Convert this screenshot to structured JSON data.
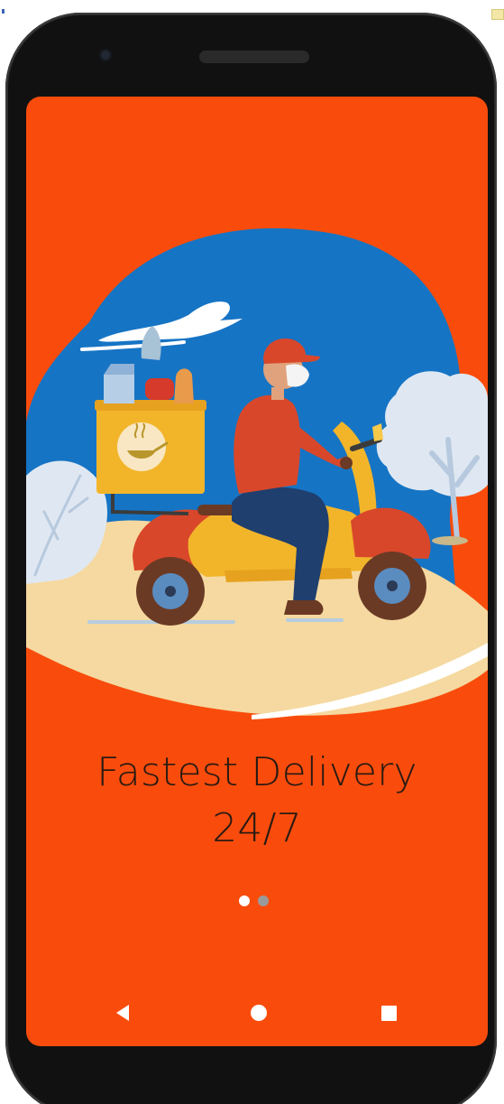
{
  "onboarding": {
    "headline_line1": "Fastest Delivery",
    "headline_line2": "24/7",
    "illustration_icon": "delivery-scooter-illustration",
    "page_count": 2,
    "active_page": 1
  },
  "navigation_bar": {
    "back_icon": "back-triangle-icon",
    "home_icon": "home-circle-icon",
    "recents_icon": "recents-square-icon"
  },
  "colors": {
    "screen_background": "#f94c0c",
    "headline_text": "#2a1a12",
    "blob_blue": "#1674c4",
    "ground_sand": "#f5d9a0",
    "scooter_yellow": "#f2b52a",
    "scooter_red": "#d9472a",
    "dot_active": "#ffffff",
    "dot_inactive": "#9a9a9a"
  }
}
